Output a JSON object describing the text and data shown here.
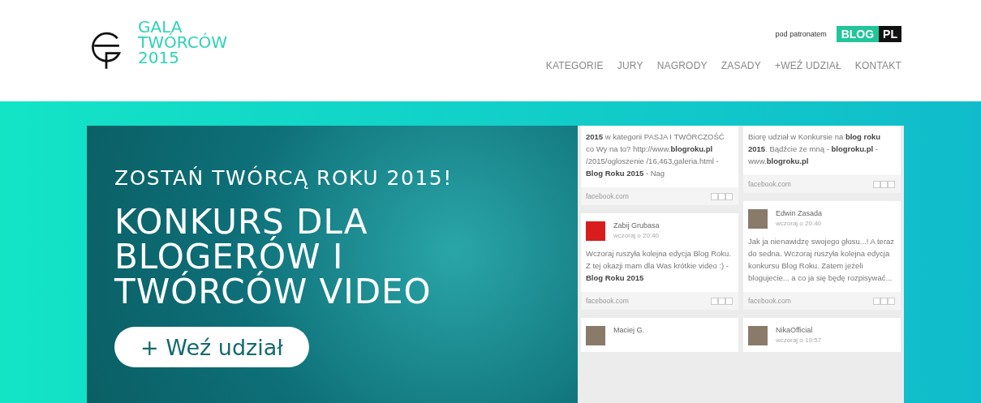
{
  "logo": {
    "lines": [
      "GALA",
      "TWÓRCÓW",
      "2015"
    ]
  },
  "patronage": {
    "label": "pod patronatem",
    "brand_left": "BLOG",
    "brand_right": "PL"
  },
  "nav": [
    "KATEGORIE",
    "JURY",
    "NAGRODY",
    "ZASADY",
    "+WEŹ UDZIAŁ",
    "KONTAKT"
  ],
  "hero": {
    "kicker": "ZOSTAŃ TWÓRCĄ ROKU 2015!",
    "title_lines": [
      "KONKURS DLA",
      "BLOGERÓW I",
      "TWÓRCÓW VIDEO"
    ],
    "button": "+ Weź udział"
  },
  "feed": [
    {
      "cards": [
        {
          "text": "**2015** w kategorii PASJA I TWÓRCZOŚĆ co Wy na to? http://www.**blogroku.pl** /2015/ogloszenie /16,463,galeria.html - **Blog Roku 2015** - Nag",
          "source": "facebook.com"
        },
        {
          "avatar": {
            "kind": "logo"
          },
          "author": "Zabij Grubasa",
          "time": "wczoraj o 20:40",
          "text": "Wczoraj ruszyła kolejna edycja Blog Roku. Z tej okazji mam dla Was krótkie video :) - **Blog Roku 2015**",
          "source": "facebook.com"
        },
        {
          "avatar": {
            "kind": "photo"
          },
          "author": "Maciej G."
        }
      ]
    },
    {
      "cards": [
        {
          "text": "Biorę udział w Konkursie na **blog roku 2015**. Bądźcie ze mną - **blogroku.pl** - www.**blogroku.pl**",
          "source": "facebook.com"
        },
        {
          "avatar": {
            "kind": "photo"
          },
          "author": "Edwin Zasada",
          "time": "wczoraj o 20:40",
          "text": "Jak ja nienawidzę swojego głosu...! A teraz do sedna. Wczoraj ruszyła kolejna edycja konkursu Blog Roku. Zatem jeżeli blogujecie... a co ja się będę rozpisywać...",
          "source": "facebook.com"
        },
        {
          "avatar": {
            "kind": "photo"
          },
          "author": "NikaOfficial",
          "time": "wczoraj o 19:57"
        }
      ]
    }
  ]
}
